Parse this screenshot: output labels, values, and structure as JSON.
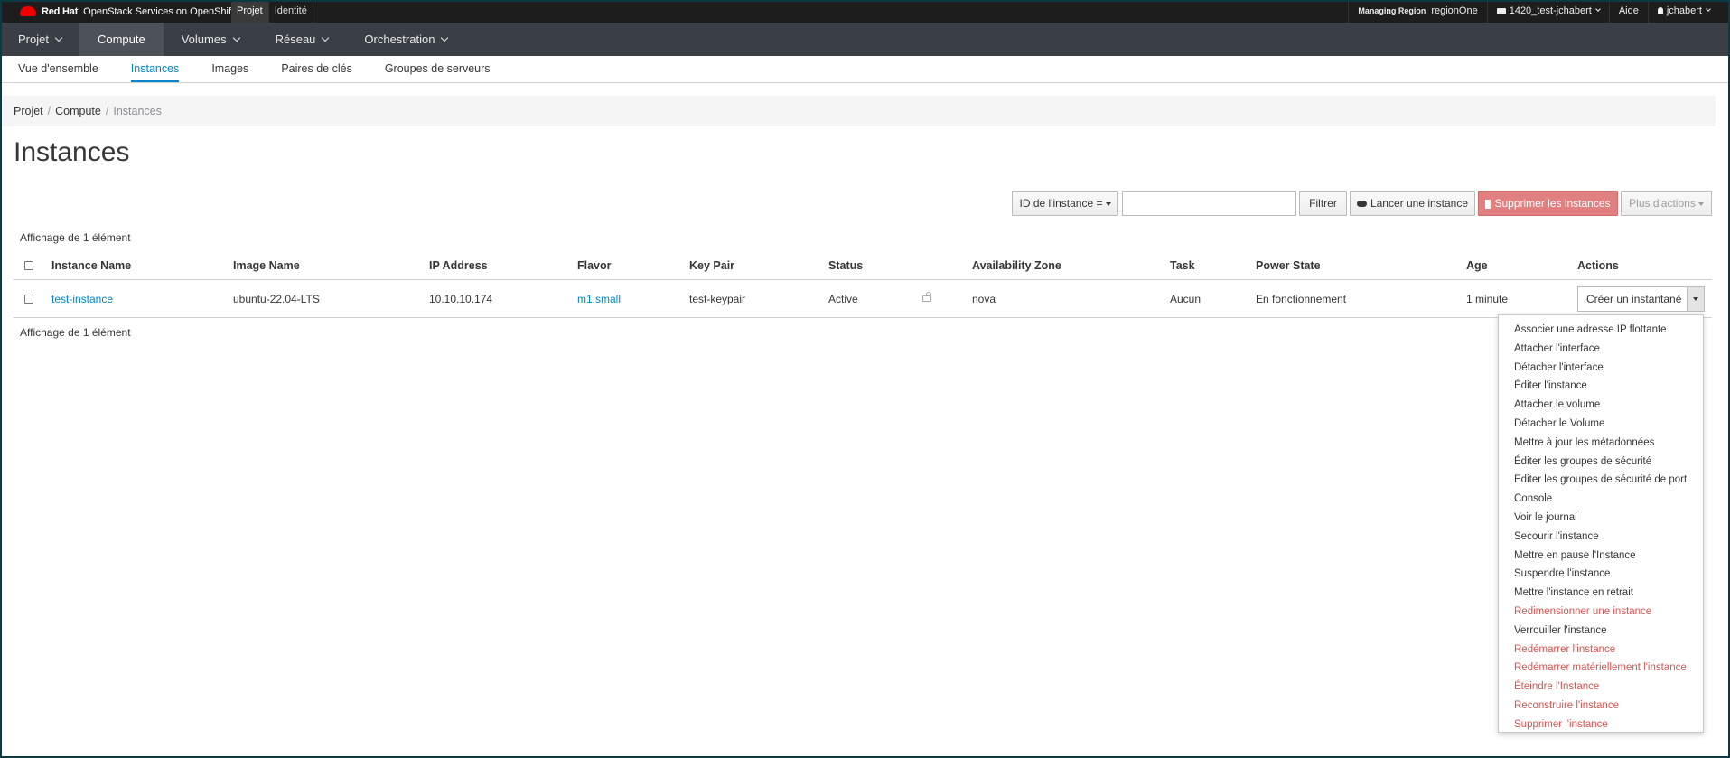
{
  "topbar": {
    "brand_redhat": "Red Hat",
    "brand_product": "OpenStack Services on OpenShift",
    "tabs": [
      {
        "label": "Projet",
        "active": true
      },
      {
        "label": "Identité",
        "active": false
      }
    ],
    "region_caption": "Managing Region",
    "region": "regionOne",
    "project": "1420_test-jchabert",
    "help": "Aide",
    "user": "jchabert"
  },
  "primary_nav": [
    {
      "label": "Projet",
      "has_caret": true,
      "active": false
    },
    {
      "label": "Compute",
      "has_caret": false,
      "active": true
    },
    {
      "label": "Volumes",
      "has_caret": true,
      "active": false
    },
    {
      "label": "Réseau",
      "has_caret": true,
      "active": false
    },
    {
      "label": "Orchestration",
      "has_caret": true,
      "active": false
    }
  ],
  "secondary_nav": [
    {
      "label": "Vue d'ensemble",
      "active": false
    },
    {
      "label": "Instances",
      "active": true
    },
    {
      "label": "Images",
      "active": false
    },
    {
      "label": "Paires de clés",
      "active": false
    },
    {
      "label": "Groupes de serveurs",
      "active": false
    }
  ],
  "breadcrumb": {
    "items": [
      "Projet",
      "Compute"
    ],
    "current": "Instances",
    "separator": "/"
  },
  "page_title": "Instances",
  "toolbar": {
    "filter_field": "ID de l'instance =",
    "filter_value": "",
    "filter_button": "Filtrer",
    "launch_button": "Lancer une instance",
    "delete_button": "Supprimer les instances",
    "more_actions": "Plus d'actions"
  },
  "count_text": "Affichage de 1 élément",
  "table": {
    "columns": [
      "Instance Name",
      "Image Name",
      "IP Address",
      "Flavor",
      "Key Pair",
      "Status",
      "Availability Zone",
      "Task",
      "Power State",
      "Age",
      "Actions"
    ],
    "rows": [
      {
        "instance_name": "test-instance",
        "image_name": "ubuntu-22.04-LTS",
        "ip_address": "10.10.10.174",
        "flavor": "m1.small",
        "key_pair": "test-keypair",
        "status": "Active",
        "availability_zone": "nova",
        "task": "Aucun",
        "power_state": "En fonctionnement",
        "age": "1 minute",
        "primary_action": "Créer un instantané"
      }
    ]
  },
  "actions_menu": [
    {
      "label": "Associer une adresse IP flottante",
      "danger": false
    },
    {
      "label": "Attacher l'interface",
      "danger": false
    },
    {
      "label": "Détacher l'interface",
      "danger": false
    },
    {
      "label": "Éditer l'instance",
      "danger": false
    },
    {
      "label": "Attacher le volume",
      "danger": false
    },
    {
      "label": "Détacher le Volume",
      "danger": false
    },
    {
      "label": "Mettre à jour les métadonnées",
      "danger": false
    },
    {
      "label": "Éditer les groupes de sécurité",
      "danger": false
    },
    {
      "label": "Editer les groupes de sécurité de port",
      "danger": false
    },
    {
      "label": "Console",
      "danger": false
    },
    {
      "label": "Voir le journal",
      "danger": false
    },
    {
      "label": "Secourir l'instance",
      "danger": false
    },
    {
      "label": "Mettre en pause l'Instance",
      "danger": false
    },
    {
      "label": "Suspendre l'instance",
      "danger": false
    },
    {
      "label": "Mettre l'instance en retrait",
      "danger": false
    },
    {
      "label": "Redimensionner une instance",
      "danger": true
    },
    {
      "label": "Verrouiller l'instance",
      "danger": false
    },
    {
      "label": "Redémarrer l'instance",
      "danger": true
    },
    {
      "label": "Redémarrer matériellement l'instance",
      "danger": true
    },
    {
      "label": "Éteindre l'Instance",
      "danger": true
    },
    {
      "label": "Reconstruire l'instance",
      "danger": true
    },
    {
      "label": "Supprimer l'instance",
      "danger": true
    }
  ],
  "colors": {
    "accent": "#0088ce",
    "danger": "#d9534f",
    "nav_bg": "#393f44",
    "topbar_bg": "#1d1d1d"
  },
  "icons": {
    "brand": "redhat-logo-icon",
    "project": "folder-icon",
    "user": "user-icon",
    "launch": "cloud-upload-icon",
    "delete": "trash-icon",
    "lock": "unlock-icon"
  }
}
